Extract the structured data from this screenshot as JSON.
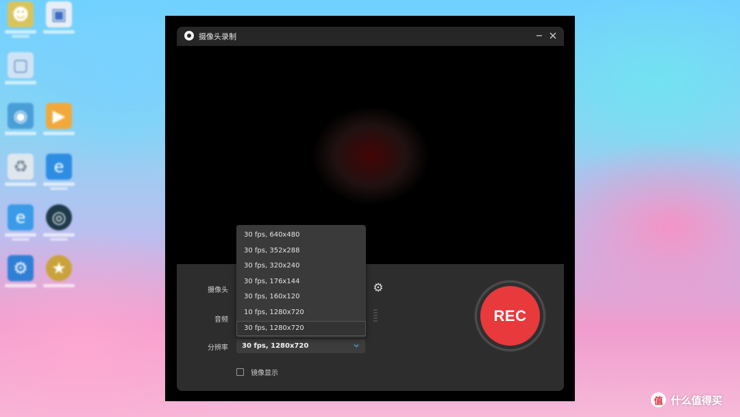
{
  "window": {
    "title": "摄像头录制"
  },
  "controls": {
    "camera_label": "摄像头",
    "audio_label": "音频",
    "resolution_label": "分辨率",
    "resolution_value": "30 fps, 1280x720",
    "mirror_label": "镜像显示",
    "mirror_checked": false
  },
  "rec_button": {
    "label": "REC",
    "color": "#e8393c"
  },
  "resolution_options": [
    "30 fps, 640x480",
    "30 fps, 352x288",
    "30 fps, 320x240",
    "30 fps, 176x144",
    "30 fps, 160x120",
    "10 fps, 1280x720",
    "30 fps, 1280x720"
  ],
  "resolution_selected_index": 6,
  "watermark": {
    "text": "什么值得买",
    "logo_glyph": "值"
  },
  "icons": {
    "settings": "gear-icon",
    "minimize": "minimize-icon",
    "close": "close-icon",
    "dropdown": "chevron-down-icon"
  }
}
